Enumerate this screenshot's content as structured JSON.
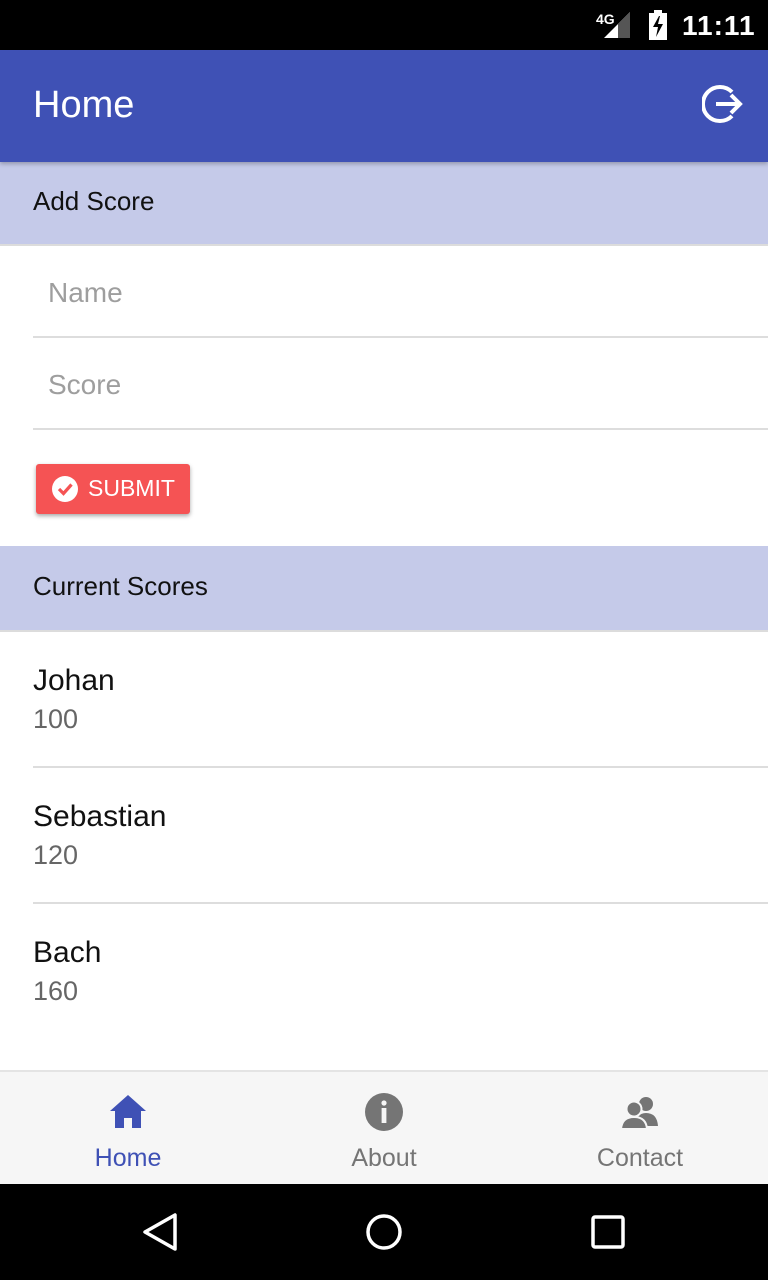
{
  "status_bar": {
    "network": "4G",
    "time": "11:11"
  },
  "app_bar": {
    "title": "Home",
    "action_icon": "logout-icon"
  },
  "add_score": {
    "header": "Add Score",
    "name_placeholder": "Name",
    "score_placeholder": "Score",
    "submit_label": "SUBMIT",
    "submit_icon": "check-circle-icon"
  },
  "current_scores": {
    "header": "Current Scores",
    "items": [
      {
        "name": "Johan",
        "score": "100"
      },
      {
        "name": "Sebastian",
        "score": "120"
      },
      {
        "name": "Bach",
        "score": "160"
      }
    ]
  },
  "bottom_nav": {
    "items": [
      {
        "label": "Home",
        "icon": "home-icon",
        "active": true
      },
      {
        "label": "About",
        "icon": "info-icon",
        "active": false
      },
      {
        "label": "Contact",
        "icon": "contacts-icon",
        "active": false
      }
    ]
  },
  "colors": {
    "primary": "#3F51B5",
    "section_header": "#C5CAE9",
    "accent": "#F55354",
    "nav_active": "#3F51B5",
    "nav_inactive": "#757575"
  }
}
